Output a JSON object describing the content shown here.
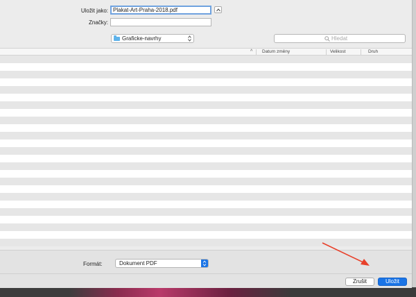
{
  "save_as": {
    "label": "Uložit jako:",
    "value": "Plakat-Art-Praha-2018.pdf"
  },
  "tags": {
    "label": "Značky:",
    "value": ""
  },
  "location": {
    "folder": "Graficke-navrhy",
    "icon": "folder-icon"
  },
  "search": {
    "placeholder": "Hledat",
    "icon": "search-icon"
  },
  "columns": {
    "date": "Datum změny",
    "size": "Velikost",
    "kind": "Druh"
  },
  "format": {
    "label": "Formát:",
    "value": "Dokument PDF"
  },
  "buttons": {
    "cancel": "Zrušit",
    "save": "Uložit"
  },
  "colors": {
    "accent": "#1a74e6",
    "annotation_arrow": "#e8402a"
  }
}
